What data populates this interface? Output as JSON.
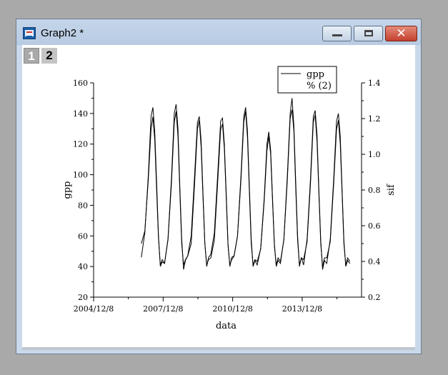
{
  "window": {
    "title": "Graph2 *",
    "close_glyph": "✕"
  },
  "layers": [
    "1",
    "2"
  ],
  "legend": {
    "entries": [
      "gpp",
      "% (2)"
    ]
  },
  "chart_data": {
    "type": "line",
    "xlabel": "data",
    "ylabel": "gpp",
    "y2label": "sif",
    "x_ticks": [
      "2004/12/8",
      "2007/12/8",
      "2010/12/8",
      "2013/12/8"
    ],
    "x_tick_positions": [
      2004.94,
      2007.94,
      2010.94,
      2013.94
    ],
    "xlim": [
      2004.94,
      2016.5
    ],
    "ylim": [
      20,
      160
    ],
    "y_ticks": [
      20,
      40,
      60,
      80,
      100,
      120,
      140,
      160
    ],
    "y2lim": [
      0.2,
      1.4
    ],
    "y2_ticks": [
      "0.2",
      "0.4",
      "0.6",
      "0.8",
      "1.0",
      "1.2",
      "1.4"
    ],
    "legend_position": "top-right",
    "series": [
      {
        "name": "gpp",
        "axis": "left",
        "x": [
          2007.0,
          2007.15,
          2007.3,
          2007.42,
          2007.5,
          2007.58,
          2007.66,
          2007.74,
          2007.82,
          2007.9,
          2008.0,
          2008.15,
          2008.3,
          2008.42,
          2008.5,
          2008.58,
          2008.66,
          2008.74,
          2008.82,
          2008.9,
          2009.0,
          2009.15,
          2009.3,
          2009.42,
          2009.5,
          2009.58,
          2009.66,
          2009.74,
          2009.82,
          2009.9,
          2010.0,
          2010.15,
          2010.3,
          2010.42,
          2010.5,
          2010.58,
          2010.66,
          2010.74,
          2010.82,
          2010.9,
          2011.0,
          2011.15,
          2011.3,
          2011.42,
          2011.5,
          2011.58,
          2011.66,
          2011.74,
          2011.82,
          2011.9,
          2012.0,
          2012.15,
          2012.3,
          2012.42,
          2012.5,
          2012.58,
          2012.66,
          2012.74,
          2012.82,
          2012.9,
          2013.0,
          2013.15,
          2013.3,
          2013.42,
          2013.5,
          2013.58,
          2013.66,
          2013.74,
          2013.82,
          2013.9,
          2014.0,
          2014.15,
          2014.3,
          2014.42,
          2014.5,
          2014.58,
          2014.66,
          2014.74,
          2014.82,
          2014.9,
          2015.0,
          2015.15,
          2015.3,
          2015.42,
          2015.5,
          2015.58,
          2015.66,
          2015.74,
          2015.82,
          2015.9,
          2016.0
        ],
        "values": [
          46,
          62,
          100,
          138,
          144,
          128,
          95,
          60,
          40,
          43,
          42,
          58,
          98,
          140,
          146,
          130,
          92,
          58,
          38,
          44,
          47,
          60,
          100,
          134,
          138,
          122,
          88,
          55,
          40,
          46,
          48,
          62,
          102,
          135,
          137,
          120,
          88,
          55,
          40,
          46,
          47,
          60,
          100,
          138,
          144,
          128,
          92,
          58,
          40,
          44,
          41,
          52,
          85,
          120,
          128,
          116,
          85,
          55,
          40,
          44,
          42,
          58,
          100,
          140,
          150,
          132,
          95,
          60,
          40,
          46,
          41,
          58,
          98,
          138,
          142,
          126,
          90,
          57,
          38,
          44,
          42,
          58,
          98,
          135,
          140,
          125,
          90,
          57,
          40,
          44,
          42
        ]
      },
      {
        "name": "% (2)",
        "axis": "right",
        "x": [
          2007.0,
          2007.15,
          2007.3,
          2007.42,
          2007.5,
          2007.58,
          2007.66,
          2007.74,
          2007.82,
          2007.9,
          2008.0,
          2008.15,
          2008.3,
          2008.42,
          2008.5,
          2008.58,
          2008.66,
          2008.74,
          2008.82,
          2008.9,
          2009.0,
          2009.15,
          2009.3,
          2009.42,
          2009.5,
          2009.58,
          2009.66,
          2009.74,
          2009.82,
          2009.9,
          2010.0,
          2010.15,
          2010.3,
          2010.42,
          2010.5,
          2010.58,
          2010.66,
          2010.74,
          2010.82,
          2010.9,
          2011.0,
          2011.15,
          2011.3,
          2011.42,
          2011.5,
          2011.58,
          2011.66,
          2011.74,
          2011.82,
          2011.9,
          2012.0,
          2012.15,
          2012.3,
          2012.42,
          2012.5,
          2012.58,
          2012.66,
          2012.74,
          2012.82,
          2012.9,
          2013.0,
          2013.15,
          2013.3,
          2013.42,
          2013.5,
          2013.58,
          2013.66,
          2013.74,
          2013.82,
          2013.9,
          2014.0,
          2014.15,
          2014.3,
          2014.42,
          2014.5,
          2014.58,
          2014.66,
          2014.74,
          2014.82,
          2014.9,
          2015.0,
          2015.15,
          2015.3,
          2015.42,
          2015.5,
          2015.58,
          2015.66,
          2015.74,
          2015.82,
          2015.9,
          2016.0
        ],
        "values": [
          0.5,
          0.57,
          0.86,
          1.14,
          1.21,
          1.08,
          0.8,
          0.53,
          0.38,
          0.41,
          0.39,
          0.52,
          0.84,
          1.18,
          1.24,
          1.1,
          0.79,
          0.5,
          0.38,
          0.41,
          0.43,
          0.5,
          0.84,
          1.14,
          1.19,
          1.04,
          0.76,
          0.5,
          0.38,
          0.41,
          0.42,
          0.52,
          0.86,
          1.14,
          1.17,
          1.03,
          0.76,
          0.49,
          0.38,
          0.41,
          0.43,
          0.54,
          0.86,
          1.18,
          1.24,
          1.09,
          0.79,
          0.5,
          0.38,
          0.41,
          0.4,
          0.47,
          0.74,
          1.02,
          1.1,
          1.0,
          0.74,
          0.49,
          0.38,
          0.42,
          0.4,
          0.52,
          0.86,
          1.2,
          1.25,
          1.13,
          0.81,
          0.52,
          0.38,
          0.42,
          0.41,
          0.51,
          0.84,
          1.18,
          1.22,
          1.07,
          0.78,
          0.5,
          0.37,
          0.42,
          0.42,
          0.51,
          0.84,
          1.14,
          1.19,
          1.06,
          0.78,
          0.5,
          0.38,
          0.42,
          0.4
        ]
      }
    ]
  }
}
